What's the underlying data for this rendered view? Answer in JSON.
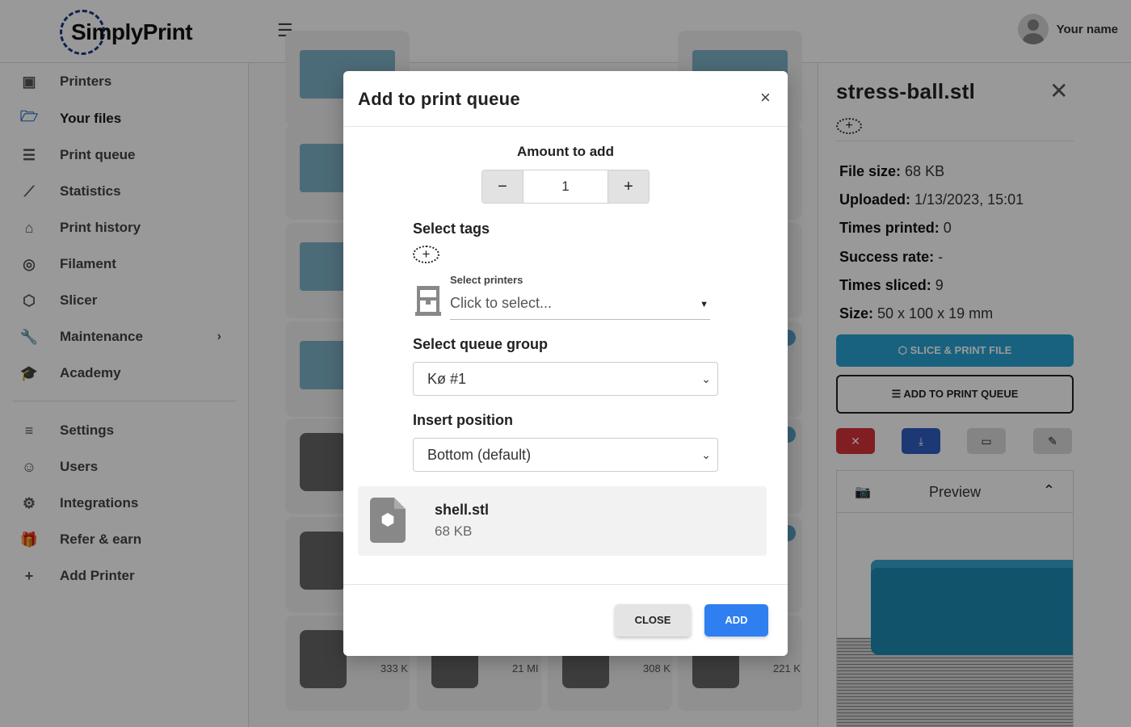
{
  "header": {
    "logo_text": "SimplyPrint",
    "user_name": "Your name"
  },
  "sidebar": {
    "items": [
      {
        "label": "Printers",
        "icon": "printer-icon"
      },
      {
        "label": "Your files",
        "icon": "folder-open-icon",
        "active": true
      },
      {
        "label": "Print queue",
        "icon": "list-icon"
      },
      {
        "label": "Statistics",
        "icon": "chart-line-icon"
      },
      {
        "label": "Print history",
        "icon": "history-icon"
      },
      {
        "label": "Filament",
        "icon": "filament-spool-icon"
      },
      {
        "label": "Slicer",
        "icon": "cube-icon"
      },
      {
        "label": "Maintenance",
        "icon": "wrench-icon"
      },
      {
        "label": "Academy",
        "icon": "graduation-cap-icon"
      },
      {
        "label": "Settings",
        "icon": "sliders-icon"
      },
      {
        "label": "Users",
        "icon": "users-icon"
      },
      {
        "label": "Integrations",
        "icon": "gears-icon"
      },
      {
        "label": "Refer & earn",
        "icon": "gift-icon"
      },
      {
        "label": "Add Printer",
        "icon": "plus-icon"
      }
    ]
  },
  "file_grid": {
    "sizes": [
      "333 K",
      "21 MI",
      "308 K",
      "221 K"
    ]
  },
  "details": {
    "file_title": "stress-ball.stl",
    "file_size_label": "File size:",
    "file_size": "68 KB",
    "uploaded_label": "Uploaded:",
    "uploaded": "1/13/2023, 15:01",
    "times_printed_label": "Times printed:",
    "times_printed": "0",
    "success_rate_label": "Success rate:",
    "success_rate": "-",
    "times_sliced_label": "Times sliced:",
    "times_sliced": "9",
    "dimensions_label": "Size:",
    "dimensions": "50 x 100 x 19 mm",
    "slice_button": "SLICE & PRINT FILE",
    "queue_button": "ADD TO PRINT QUEUE",
    "preview_title": "Preview",
    "colors": {
      "slice": "#29a3d6",
      "delete": "#d6323a",
      "download": "#2f5fc5"
    }
  },
  "modal": {
    "title": "Add to print queue",
    "close_symbol": "×",
    "amount_label": "Amount to add",
    "amount_value": "1",
    "minus": "−",
    "plus": "+",
    "tags_label": "Select tags",
    "tags_add": "+",
    "printers_label": "Select printers",
    "printers_placeholder": "Click to select...",
    "group_label": "Select queue group",
    "group_value": "Kø #1",
    "position_label": "Insert position",
    "position_value": "Bottom (default)",
    "file": {
      "name": "shell.stl",
      "size": "68 KB"
    },
    "close_button": "CLOSE",
    "add_button": "ADD",
    "colors": {
      "add": "#2f7ff0",
      "close": "#e4e4e4"
    }
  }
}
